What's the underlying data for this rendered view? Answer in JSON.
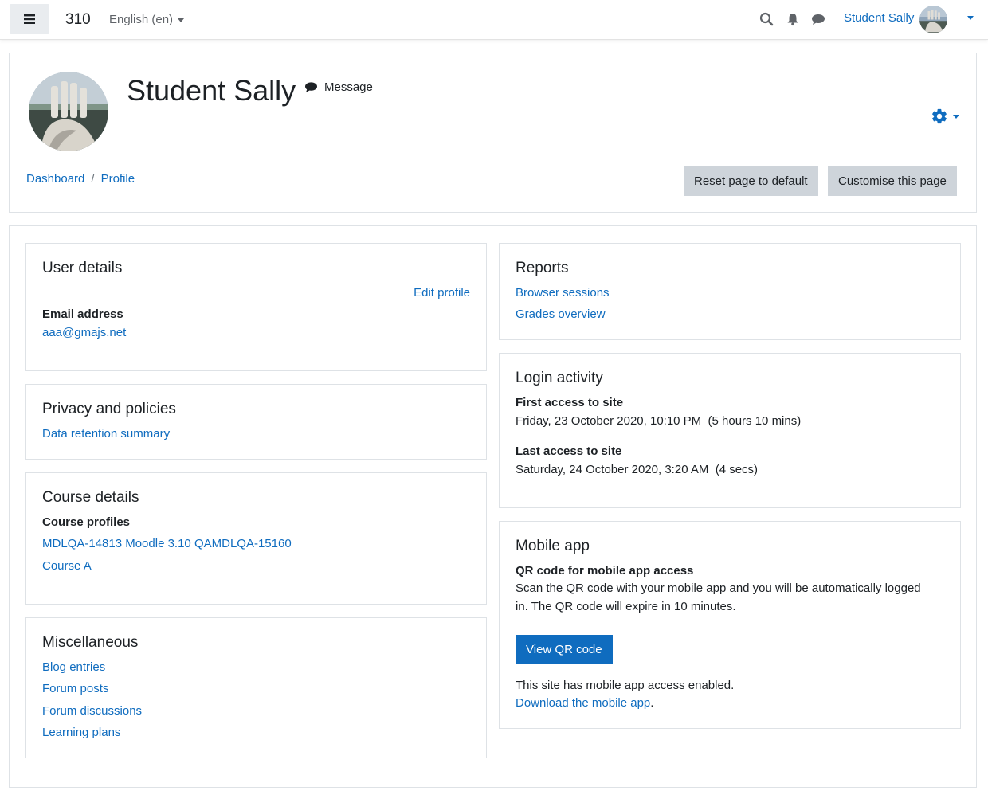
{
  "navbar": {
    "site_name": "310",
    "language": "English (en)",
    "user_name": "Student Sally"
  },
  "header": {
    "name": "Student Sally",
    "message_label": "Message",
    "breadcrumb": [
      "Dashboard",
      "Profile"
    ],
    "reset_button": "Reset page to default",
    "customise_button": "Customise this page"
  },
  "user_details": {
    "title": "User details",
    "edit_profile": "Edit profile",
    "email_label": "Email address",
    "email_value": "aaa@gmajs.net"
  },
  "privacy": {
    "title": "Privacy and policies",
    "link": "Data retention summary"
  },
  "course_details": {
    "title": "Course details",
    "label": "Course profiles",
    "courses": [
      "MDLQA-14813 Moodle 3.10 QAMDLQA-15160",
      "Course A"
    ]
  },
  "misc": {
    "title": "Miscellaneous",
    "links": [
      "Blog entries",
      "Forum posts",
      "Forum discussions",
      "Learning plans"
    ]
  },
  "reports": {
    "title": "Reports",
    "links": [
      "Browser sessions",
      "Grades overview"
    ]
  },
  "login_activity": {
    "title": "Login activity",
    "first_label": "First access to site",
    "first_value": "Friday, 23 October 2020, 10:10 PM  (5 hours 10 mins)",
    "last_label": "Last access to site",
    "last_value": "Saturday, 24 October 2020, 3:20 AM  (4 secs)"
  },
  "mobile_app": {
    "title": "Mobile app",
    "qr_label": "QR code for mobile app access",
    "qr_text_1": "Scan the QR code with your mobile app and you will be automatically logged",
    "qr_text_2": "in. The QR code will expire in 10 minutes.",
    "qr_button": "View QR code",
    "enabled_text": "This site has mobile app access enabled.",
    "download_link": "Download the mobile app",
    "download_suffix": "."
  },
  "colors": {
    "link": "#0f6cbf",
    "button_secondary": "#ced4da",
    "button_primary": "#0f6cbf"
  }
}
